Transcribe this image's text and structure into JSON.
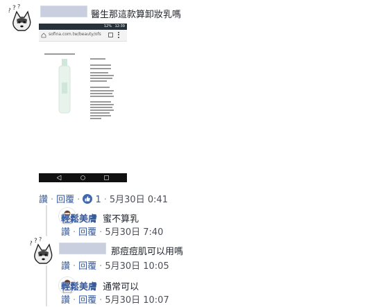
{
  "comments": [
    {
      "author": "",
      "text": "醫生那這款算卸妝乳嗎",
      "actions": {
        "like": "讚",
        "reply": "回覆",
        "likes_count": "1",
        "time": "5月30日 0:41"
      },
      "attachment": {
        "url_text": "sofina.com.tw/beauty/ofs",
        "status_time": "12:39",
        "status_battery": "12%"
      }
    },
    {
      "author": "輕鬆美膚",
      "text": "蜜不算乳",
      "actions": {
        "like": "讚",
        "reply": "回覆",
        "time": "5月30日 7:40"
      }
    },
    {
      "author": "",
      "text": "那痘痘肌可以用嗎",
      "actions": {
        "like": "讚",
        "reply": "回覆",
        "time": "5月30日 10:05"
      }
    },
    {
      "author": "輕鬆美膚",
      "text": "通常可以",
      "actions": {
        "like": "讚",
        "reply": "回覆",
        "time": "5月30日 10:07"
      }
    }
  ],
  "colors": {
    "link": "#365899",
    "meta": "#90949c",
    "like_badge": "#4267b2",
    "name_blur": "#c9cfdf"
  }
}
